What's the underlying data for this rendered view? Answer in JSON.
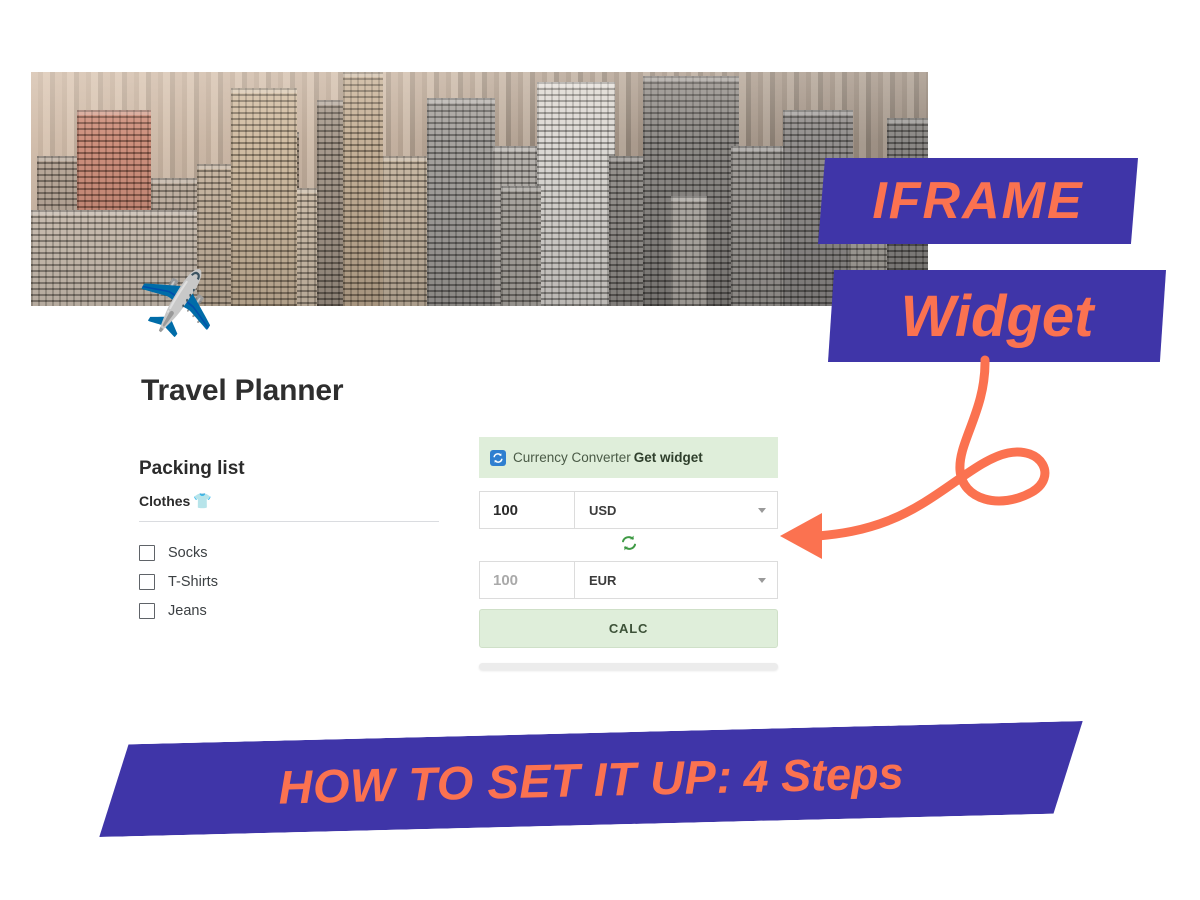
{
  "page": {
    "background_color": "#ffffff",
    "accent_purple": "#3f35a8",
    "accent_coral": "#fb7250",
    "widget_green": "#dfeeda"
  },
  "hero": {
    "alt": "sepia city skyline photo",
    "plane_icon": "✈️"
  },
  "title": {
    "text": "Travel Planner"
  },
  "packing": {
    "heading": "Packing list",
    "category": "Clothes",
    "category_icon": "👕",
    "items": [
      {
        "label": "Socks",
        "checked": false
      },
      {
        "label": "T-Shirts",
        "checked": false
      },
      {
        "label": "Jeans",
        "checked": false
      }
    ]
  },
  "widget": {
    "header_title": "Currency Converter",
    "header_link": "Get widget",
    "icon_name": "currency-refresh-icon",
    "from": {
      "amount": "100",
      "currency": "USD"
    },
    "swap_icon": "refresh-swap-icon",
    "to": {
      "amount": "100",
      "currency": "EUR"
    },
    "calc_button": "CALC"
  },
  "badges": {
    "iframe": "IFRAME",
    "widget": "Widget"
  },
  "bottom_banner": {
    "main": "HOW TO SET IT UP:",
    "tail": "4 Steps"
  }
}
